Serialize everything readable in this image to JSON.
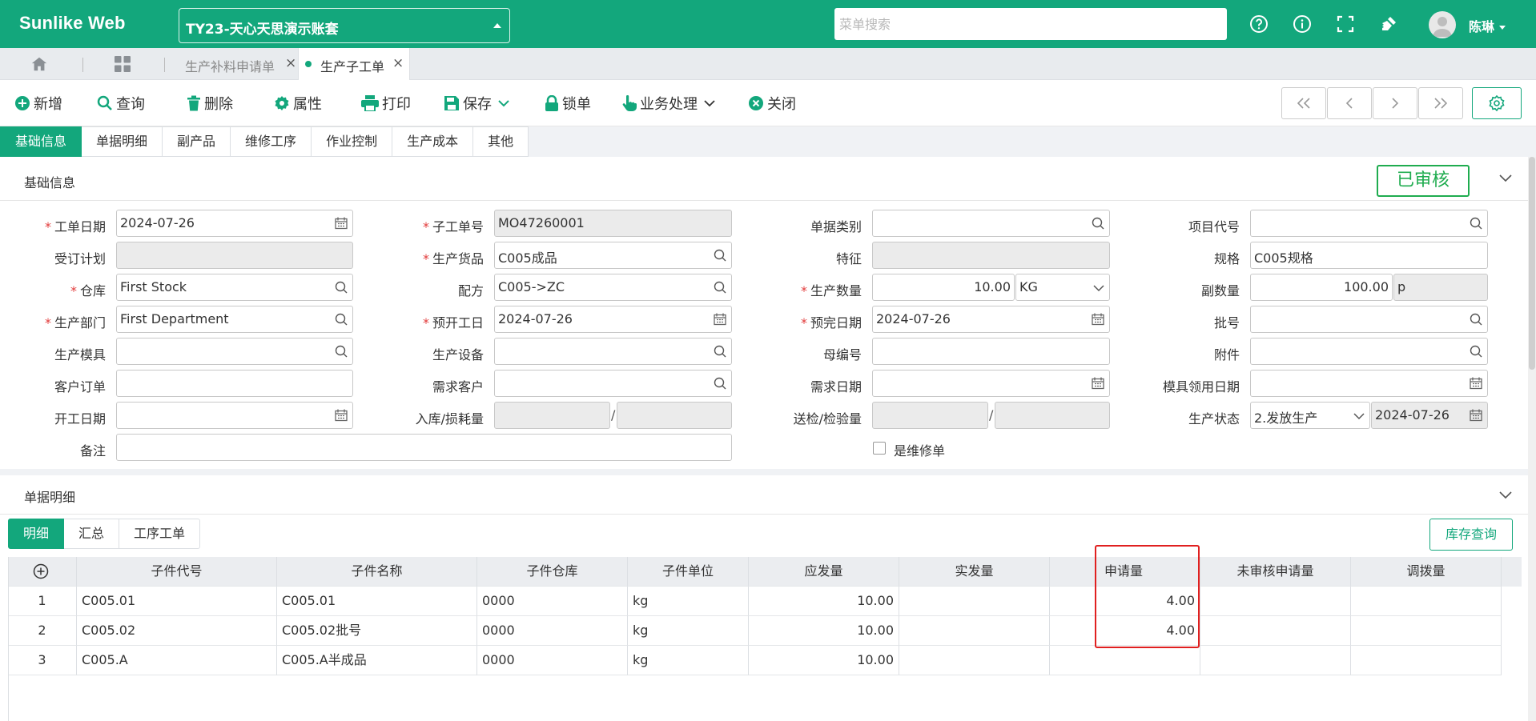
{
  "topbar": {
    "brand": "Sunlike Web",
    "account": "TY23-天心天思演示账套",
    "search_placeholder": "菜单搜索",
    "user_name": "陈琳"
  },
  "tabs": [
    {
      "label": "生产补料申请单",
      "active": false
    },
    {
      "label": "生产子工单",
      "active": true
    }
  ],
  "toolbar": {
    "add": "新增",
    "query": "查询",
    "delete": "删除",
    "properties": "属性",
    "print": "打印",
    "save": "保存",
    "lock": "锁单",
    "business": "业务处理",
    "close": "关闭"
  },
  "section_tabs": [
    "基础信息",
    "单据明细",
    "副产品",
    "维修工序",
    "作业控制",
    "生产成本",
    "其他"
  ],
  "basic": {
    "title": "基础信息",
    "status": "已审核",
    "labels": {
      "order_date": "工单日期",
      "sub_order_no": "子工单号",
      "doc_type": "单据类别",
      "project_code": "项目代号",
      "plan": "受订计划",
      "product": "生产货品",
      "feature": "特征",
      "spec": "规格",
      "warehouse": "仓库",
      "formula": "配方",
      "qty": "生产数量",
      "sub_qty": "副数量",
      "department": "生产部门",
      "plan_start": "预开工日",
      "plan_finish": "预完日期",
      "batch": "批号",
      "mold": "生产模具",
      "equipment": "生产设备",
      "parent_no": "母编号",
      "attachment": "附件",
      "customer_order": "客户订单",
      "demand_customer": "需求客户",
      "demand_date": "需求日期",
      "mold_date": "模具领用日期",
      "start_date": "开工日期",
      "in_loss": "入库/损耗量",
      "inspect": "送检/检验量",
      "prod_status": "生产状态",
      "remark": "备注",
      "is_repair": "是维修单"
    },
    "values": {
      "order_date": "2024-07-26",
      "sub_order_no": "MO47260001",
      "product": "C005成品",
      "spec": "C005规格",
      "warehouse": "First Stock",
      "formula": "C005->ZC",
      "qty": "10.00",
      "unit": "KG",
      "sub_qty": "100.00",
      "sub_unit": "p",
      "department": "First Department",
      "plan_start": "2024-07-26",
      "plan_finish": "2024-07-26",
      "prod_status": "2.发放生产",
      "status_date": "2024-07-26",
      "slash": "/"
    }
  },
  "detail": {
    "title": "单据明细",
    "subtabs": [
      "明细",
      "汇总",
      "工序工单"
    ],
    "stock_query": "库存查询",
    "columns": [
      "子件代号",
      "子件名称",
      "子件仓库",
      "子件单位",
      "应发量",
      "实发量",
      "申请量",
      "未审核申请量",
      "调拨量"
    ],
    "rows": [
      {
        "no": "1",
        "code": "C005.01",
        "name": "C005.01",
        "wh": "0000",
        "unit": "kg",
        "due": "10.00",
        "actual": "",
        "apply": "4.00",
        "unapproved": "",
        "transfer": ""
      },
      {
        "no": "2",
        "code": "C005.02",
        "name": "C005.02批号",
        "wh": "0000",
        "unit": "kg",
        "due": "10.00",
        "actual": "",
        "apply": "4.00",
        "unapproved": "",
        "transfer": ""
      },
      {
        "no": "3",
        "code": "C005.A",
        "name": "C005.A半成品",
        "wh": "0000",
        "unit": "kg",
        "due": "10.00",
        "actual": "",
        "apply": "",
        "unapproved": "",
        "transfer": ""
      }
    ]
  },
  "colors": {
    "accent": "#13a77c",
    "approved": "#1fac4f",
    "required": "#e23b3b",
    "highlight": "#e02020"
  }
}
